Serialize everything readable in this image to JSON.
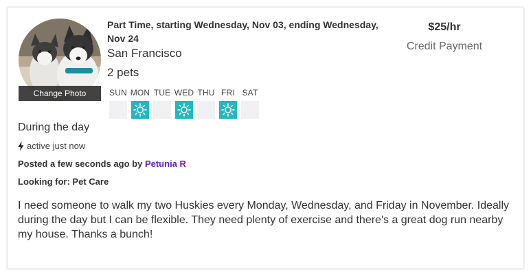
{
  "avatar": {
    "change_photo_label": "Change Photo"
  },
  "job": {
    "schedule_title": "Part Time, starting Wednesday, Nov 03, ending Wednesday, Nov 24",
    "city": "San Francisco",
    "pets": "2 pets",
    "rate": "$25/hr",
    "payment": "Credit Payment",
    "time_of_day": "During the day",
    "activity": "active just now",
    "posted_prefix": "Posted a few seconds ago by",
    "poster_name": "Petunia R",
    "looking_for": "Looking for: Pet Care",
    "description": "I need someone to walk my two Huskies every Monday, Wednesday, and Friday in November. Ideally during the day but I can be flexible. They need plenty of exercise and there's a great dog run nearby my house. Thanks a bunch!"
  },
  "days": [
    {
      "label": "SUN",
      "active": false
    },
    {
      "label": "MON",
      "active": true
    },
    {
      "label": "TUE",
      "active": false
    },
    {
      "label": "WED",
      "active": true
    },
    {
      "label": "THU",
      "active": false
    },
    {
      "label": "FRI",
      "active": true
    },
    {
      "label": "SAT",
      "active": false
    }
  ],
  "colors": {
    "accent": "#21b8c4",
    "link": "#6a1fb5",
    "inactive_day": "#f1f1f3"
  },
  "icons": {
    "day_active": "sun-icon",
    "activity": "lightning-bolt-icon"
  }
}
